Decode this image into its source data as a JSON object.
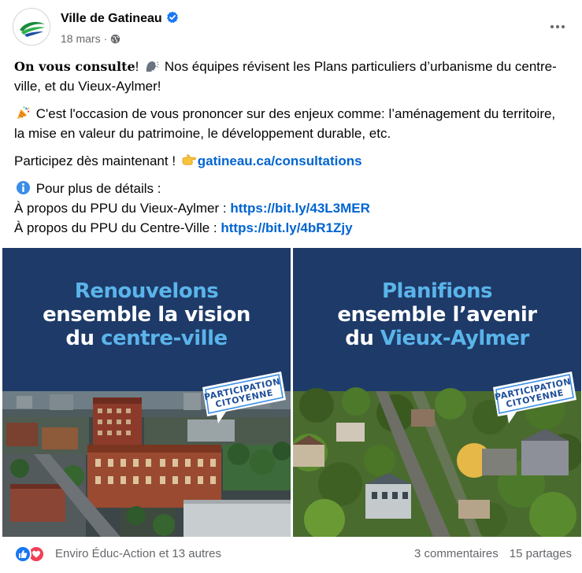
{
  "page": {
    "name": "Ville de Gatineau",
    "date": "18 mars",
    "separator": "·"
  },
  "post": {
    "intro_bold": "On vous consulte",
    "intro_rest": "! ",
    "intro_text": " Nos équipes révisent les Plans particuliers d’urbanisme du centre-ville, et du Vieux-Aylmer!",
    "para2": " C'est l'occasion de vous prononcer sur des enjeux comme: l’aménagement du territoire, la mise en valeur du patrimoine, le développement durable, etc.",
    "para3_text": "Participez dès maintenant ! ",
    "para3_link": "gatineau.ca/consultations",
    "details_label": " Pour plus de détails :",
    "line_aylmer": "À propos du PPU du Vieux-Aylmer : ",
    "link_aylmer": "https://bit.ly/43L3MER",
    "line_centre": "À propos du PPU du Centre-Ville : ",
    "link_centre": "https://bit.ly/4bR1Zjy"
  },
  "images": {
    "left": {
      "line1": "Renouvelons",
      "line2": "ensemble la vision",
      "line3_pre": "du ",
      "line3_accent": "centre-ville"
    },
    "right": {
      "line1": "Planifions",
      "line2": "ensemble l’avenir",
      "line3_pre": "du ",
      "line3_accent": "Vieux-Aylmer"
    },
    "badge_line1": "PARTICIPATION",
    "badge_line2": "CITOYENNE"
  },
  "footer": {
    "reactions": "Enviro Éduc-Action et 13 autres",
    "comments": "3 commentaires",
    "shares": "15 partages"
  },
  "icons": {
    "verified": "verified-badge-icon",
    "globe": "globe-icon",
    "more": "more-options-icon",
    "speaking": "speaking-head-icon",
    "party": "party-popper-icon",
    "pointing": "pointing-right-icon",
    "info": "info-icon",
    "like": "like-reaction-icon",
    "love": "love-reaction-icon"
  },
  "colors": {
    "link": "#0064d1",
    "meta": "#65676b",
    "banner": "#1e3a68",
    "accent": "#5ab4ea",
    "like": "#1877f2",
    "love": "#f33e58"
  }
}
